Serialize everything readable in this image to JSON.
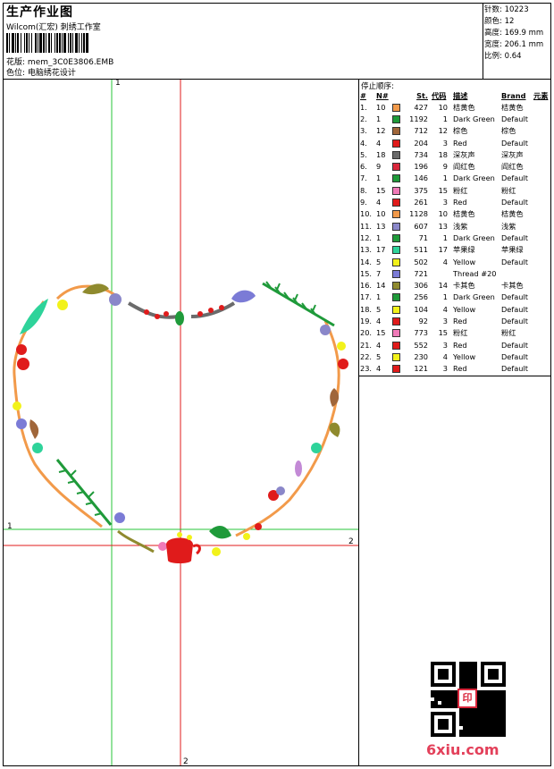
{
  "header": {
    "title": "生产作业图",
    "subtitle": "Wilcom(汇宏) 刺绣工作室",
    "pattern_label": "花版:",
    "pattern_value": "mem_3C0E3806.EMB",
    "position_label": "色位:",
    "position_value": "电脑绣花设计"
  },
  "stats": [
    {
      "label": "针数:",
      "value": "10223"
    },
    {
      "label": "颜色:",
      "value": "12"
    },
    {
      "label": "高度:",
      "value": "169.9 mm"
    },
    {
      "label": "宽度:",
      "value": "206.1 mm"
    },
    {
      "label": "比例:",
      "value": "0.64"
    }
  ],
  "sequence": {
    "title": "停止顺序:",
    "columns": [
      "#",
      "N#",
      "St.",
      "代码",
      "描述",
      "Brand",
      "元素"
    ],
    "rows": [
      {
        "idx": "1.",
        "n": "10",
        "color": "#f29a4a",
        "st": "427",
        "code": "10",
        "desc": "桔黄色",
        "brand": "桔黄色"
      },
      {
        "idx": "2.",
        "n": "1",
        "color": "#1f9a3a",
        "st": "1192",
        "code": "1",
        "desc": "Dark Green",
        "brand": "Default"
      },
      {
        "idx": "3.",
        "n": "12",
        "color": "#a0663a",
        "st": "712",
        "code": "12",
        "desc": "棕色",
        "brand": "棕色"
      },
      {
        "idx": "4.",
        "n": "4",
        "color": "#e01b1b",
        "st": "204",
        "code": "3",
        "desc": "Red",
        "brand": "Default"
      },
      {
        "idx": "5.",
        "n": "18",
        "color": "#6b6b6b",
        "st": "734",
        "code": "18",
        "desc": "深灰声",
        "brand": "深灰声"
      },
      {
        "idx": "6.",
        "n": "9",
        "color": "#d9263b",
        "st": "196",
        "code": "9",
        "desc": "阎红色",
        "brand": "阎红色"
      },
      {
        "idx": "7.",
        "n": "1",
        "color": "#1f9a3a",
        "st": "146",
        "code": "1",
        "desc": "Dark Green",
        "brand": "Default"
      },
      {
        "idx": "8.",
        "n": "15",
        "color": "#f07ab8",
        "st": "375",
        "code": "15",
        "desc": "粉红",
        "brand": "粉红"
      },
      {
        "idx": "9.",
        "n": "4",
        "color": "#e01b1b",
        "st": "261",
        "code": "3",
        "desc": "Red",
        "brand": "Default"
      },
      {
        "idx": "10.",
        "n": "10",
        "color": "#f29a4a",
        "st": "1128",
        "code": "10",
        "desc": "桔黄色",
        "brand": "桔黄色"
      },
      {
        "idx": "11.",
        "n": "13",
        "color": "#8a87c9",
        "st": "607",
        "code": "13",
        "desc": "浅紫",
        "brand": "浅紫"
      },
      {
        "idx": "12.",
        "n": "1",
        "color": "#1f9a3a",
        "st": "71",
        "code": "1",
        "desc": "Dark Green",
        "brand": "Default"
      },
      {
        "idx": "13.",
        "n": "17",
        "color": "#2ed39a",
        "st": "511",
        "code": "17",
        "desc": "苹果绿",
        "brand": "苹果绿"
      },
      {
        "idx": "14.",
        "n": "5",
        "color": "#f2f21a",
        "st": "502",
        "code": "4",
        "desc": "Yellow",
        "brand": "Default"
      },
      {
        "idx": "15.",
        "n": "7",
        "color": "#7b7bd6",
        "st": "721",
        "code": "",
        "desc": "Thread #20",
        "brand": ""
      },
      {
        "idx": "16.",
        "n": "14",
        "color": "#8f8a2e",
        "st": "306",
        "code": "14",
        "desc": "卡其色",
        "brand": "卡其色"
      },
      {
        "idx": "17.",
        "n": "1",
        "color": "#1f9a3a",
        "st": "256",
        "code": "1",
        "desc": "Dark Green",
        "brand": "Default"
      },
      {
        "idx": "18.",
        "n": "5",
        "color": "#f2f21a",
        "st": "104",
        "code": "4",
        "desc": "Yellow",
        "brand": "Default"
      },
      {
        "idx": "19.",
        "n": "4",
        "color": "#e01b1b",
        "st": "92",
        "code": "3",
        "desc": "Red",
        "brand": "Default"
      },
      {
        "idx": "20.",
        "n": "15",
        "color": "#f07ab8",
        "st": "773",
        "code": "15",
        "desc": "粉红",
        "brand": "粉红"
      },
      {
        "idx": "21.",
        "n": "4",
        "color": "#e01b1b",
        "st": "552",
        "code": "3",
        "desc": "Red",
        "brand": "Default"
      },
      {
        "idx": "22.",
        "n": "5",
        "color": "#f2f21a",
        "st": "230",
        "code": "4",
        "desc": "Yellow",
        "brand": "Default"
      },
      {
        "idx": "23.",
        "n": "4",
        "color": "#e01b1b",
        "st": "121",
        "code": "3",
        "desc": "Red",
        "brand": "Default"
      }
    ]
  },
  "canvas": {
    "axis_labels": {
      "top": "1",
      "bottom": "2",
      "left": "1",
      "right": "2"
    },
    "accent_green": "#27c43a",
    "accent_red": "#e01b1b"
  },
  "brand_mark": "6xiu.com",
  "qr_stamp": "印"
}
